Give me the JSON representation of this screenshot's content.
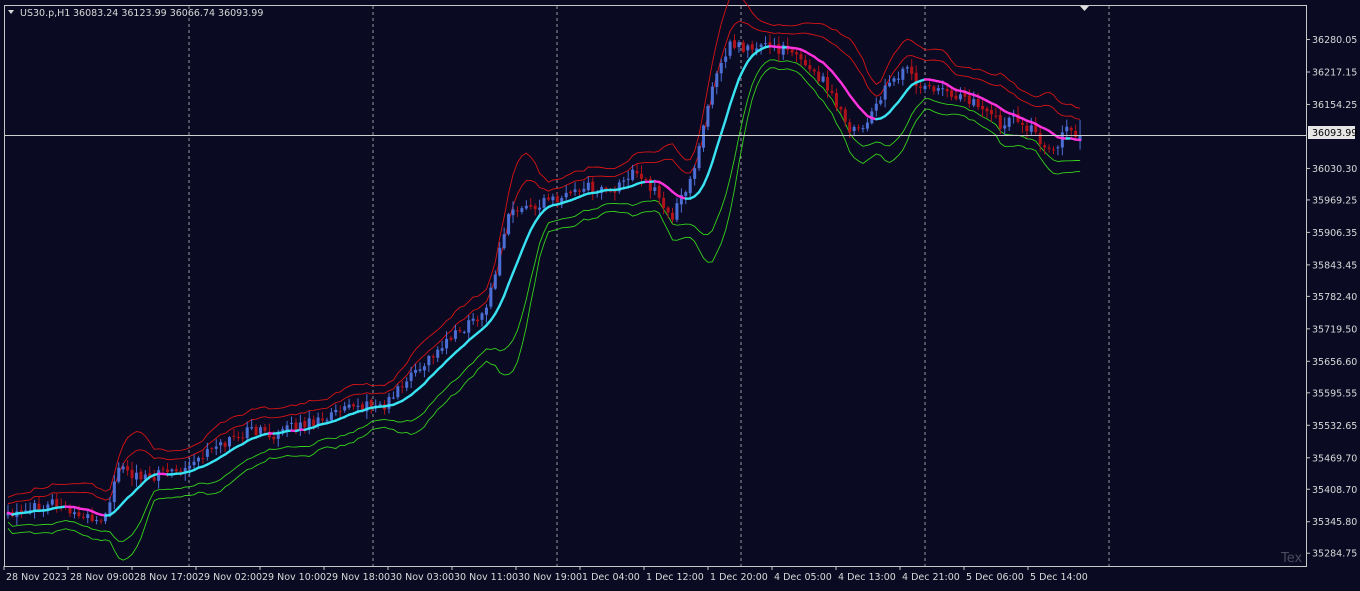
{
  "header": {
    "symbol": "US30.p,H1",
    "ohlc": "36083.24 36123.99 36066.74 36093.99"
  },
  "current_price_label": "36093.99",
  "corner_watermark": "Tex",
  "colors": {
    "background": "#0a0a23",
    "axis": "#c8c8c8",
    "grid": "#c8c8c8",
    "bull": "#4c6fd6",
    "bear": "#b01219",
    "ma_up": "#39e3f2",
    "ma_down": "#ff33dd",
    "upper_band": "#d81414",
    "lower_band": "#35d21a",
    "price_line": "#d0d0d0"
  },
  "chart_data": {
    "type": "candlestick",
    "title": "US30.p,H1",
    "y_axis": {
      "side": "right",
      "range": [
        35260,
        36345
      ],
      "ticks": [
        "36280.05",
        "36217.15",
        "36154.25",
        "36093.99",
        "36030.30",
        "35969.25",
        "35906.35",
        "35843.45",
        "35782.40",
        "35719.50",
        "35656.60",
        "35595.55",
        "35532.65",
        "35469.70",
        "35408.70",
        "35345.80",
        "35284.75"
      ]
    },
    "x_axis": {
      "ticks": [
        "28 Nov 2023",
        "28 Nov 09:00",
        "28 Nov 17:00",
        "29 Nov 02:00",
        "29 Nov 10:00",
        "29 Nov 18:00",
        "30 Nov 03:00",
        "30 Nov 11:00",
        "30 Nov 19:00",
        "1 Dec 04:00",
        "1 Dec 12:00",
        "1 Dec 20:00",
        "4 Dec 05:00",
        "4 Dec 13:00",
        "4 Dec 21:00",
        "5 Dec 06:00",
        "5 Dec 14:00"
      ]
    },
    "day_separators": [
      "28 Nov 17:00",
      "29 Nov 13:00",
      "30 Nov 09:00",
      "1 Dec 04:00",
      "1 Dec 20:00",
      "4 Dec 17:00",
      "5 Dec 13:00"
    ],
    "current_price": 36093.99,
    "close_anchors": [
      [
        0,
        35365
      ],
      [
        10,
        35385
      ],
      [
        18,
        35350
      ],
      [
        22,
        35355
      ],
      [
        25,
        35455
      ],
      [
        30,
        35425
      ],
      [
        40,
        35455
      ],
      [
        50,
        35505
      ],
      [
        55,
        35525
      ],
      [
        60,
        35515
      ],
      [
        70,
        35545
      ],
      [
        80,
        35570
      ],
      [
        85,
        35570
      ],
      [
        92,
        35640
      ],
      [
        100,
        35700
      ],
      [
        108,
        35760
      ],
      [
        113,
        35945
      ],
      [
        120,
        35960
      ],
      [
        130,
        35995
      ],
      [
        137,
        35985
      ],
      [
        142,
        36030
      ],
      [
        145,
        35995
      ],
      [
        150,
        35935
      ],
      [
        155,
        36030
      ],
      [
        158,
        36160
      ],
      [
        163,
        36270
      ],
      [
        168,
        36260
      ],
      [
        172,
        36270
      ],
      [
        175,
        36260
      ],
      [
        180,
        36235
      ],
      [
        185,
        36190
      ],
      [
        190,
        36110
      ],
      [
        193,
        36110
      ],
      [
        197,
        36170
      ],
      [
        200,
        36200
      ],
      [
        203,
        36230
      ],
      [
        205,
        36190
      ],
      [
        210,
        36180
      ],
      [
        215,
        36170
      ],
      [
        220,
        36150
      ],
      [
        224,
        36115
      ],
      [
        227,
        36140
      ],
      [
        232,
        36095
      ],
      [
        236,
        36060
      ],
      [
        239,
        36110
      ],
      [
        242,
        36093.99
      ]
    ],
    "series": [
      {
        "name": "MA",
        "color_up": "#39e3f2",
        "color_down": "#ff33dd"
      },
      {
        "name": "Upper band",
        "color": "#d81414"
      },
      {
        "name": "Lower band",
        "color": "#35d21a"
      }
    ]
  }
}
